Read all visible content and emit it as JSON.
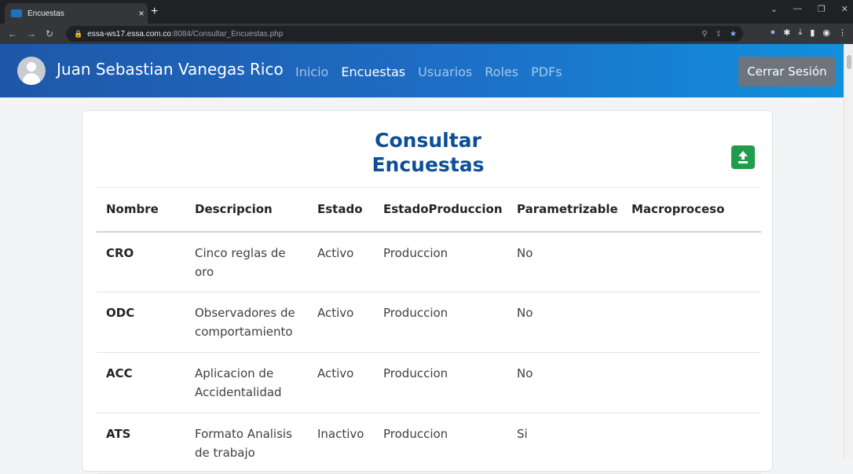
{
  "browser": {
    "tab_title": "Encuestas",
    "tab_close": "×",
    "new_tab": "+",
    "url_host": "essa-ws17.essa.com.co",
    "url_path": ":8084/Consultar_Encuestas.php"
  },
  "navbar": {
    "username": "Juan Sebastian Vanegas Rico",
    "links": [
      "Inicio",
      "Encuestas",
      "Usuarios",
      "Roles",
      "PDFs"
    ],
    "active_link": "Encuestas",
    "logout_label": "Cerrar Sesión",
    "gradient": [
      "#1f57a8",
      "#1190dc"
    ]
  },
  "card": {
    "title_line1": "Consultar",
    "title_line2": "Encuestas",
    "title_color": "#0d4e96",
    "upload_button_color": "#1f9d4c"
  },
  "table": {
    "headers": [
      "Nombre",
      "Descripcion",
      "Estado",
      "EstadoProduccion",
      "Parametrizable",
      "Macroproceso"
    ],
    "rows": [
      {
        "nombre": "CRO",
        "descripcion_1": "Cinco reglas de",
        "descripcion_2": "oro",
        "estado": "Activo",
        "estado_produccion": "Produccion",
        "parametrizable": "No",
        "macroproceso": ""
      },
      {
        "nombre": "ODC",
        "descripcion_1": "Observadores de",
        "descripcion_2": "comportamiento",
        "estado": "Activo",
        "estado_produccion": "Produccion",
        "parametrizable": "No",
        "macroproceso": ""
      },
      {
        "nombre": "ACC",
        "descripcion_1": "Aplicacion de",
        "descripcion_2": "Accidentalidad",
        "estado": "Activo",
        "estado_produccion": "Produccion",
        "parametrizable": "No",
        "macroproceso": ""
      },
      {
        "nombre": "ATS",
        "descripcion_1": "Formato Analisis",
        "descripcion_2": "de trabajo",
        "estado": "Inactivo",
        "estado_produccion": "Produccion",
        "parametrizable": "Si",
        "macroproceso": ""
      }
    ]
  }
}
